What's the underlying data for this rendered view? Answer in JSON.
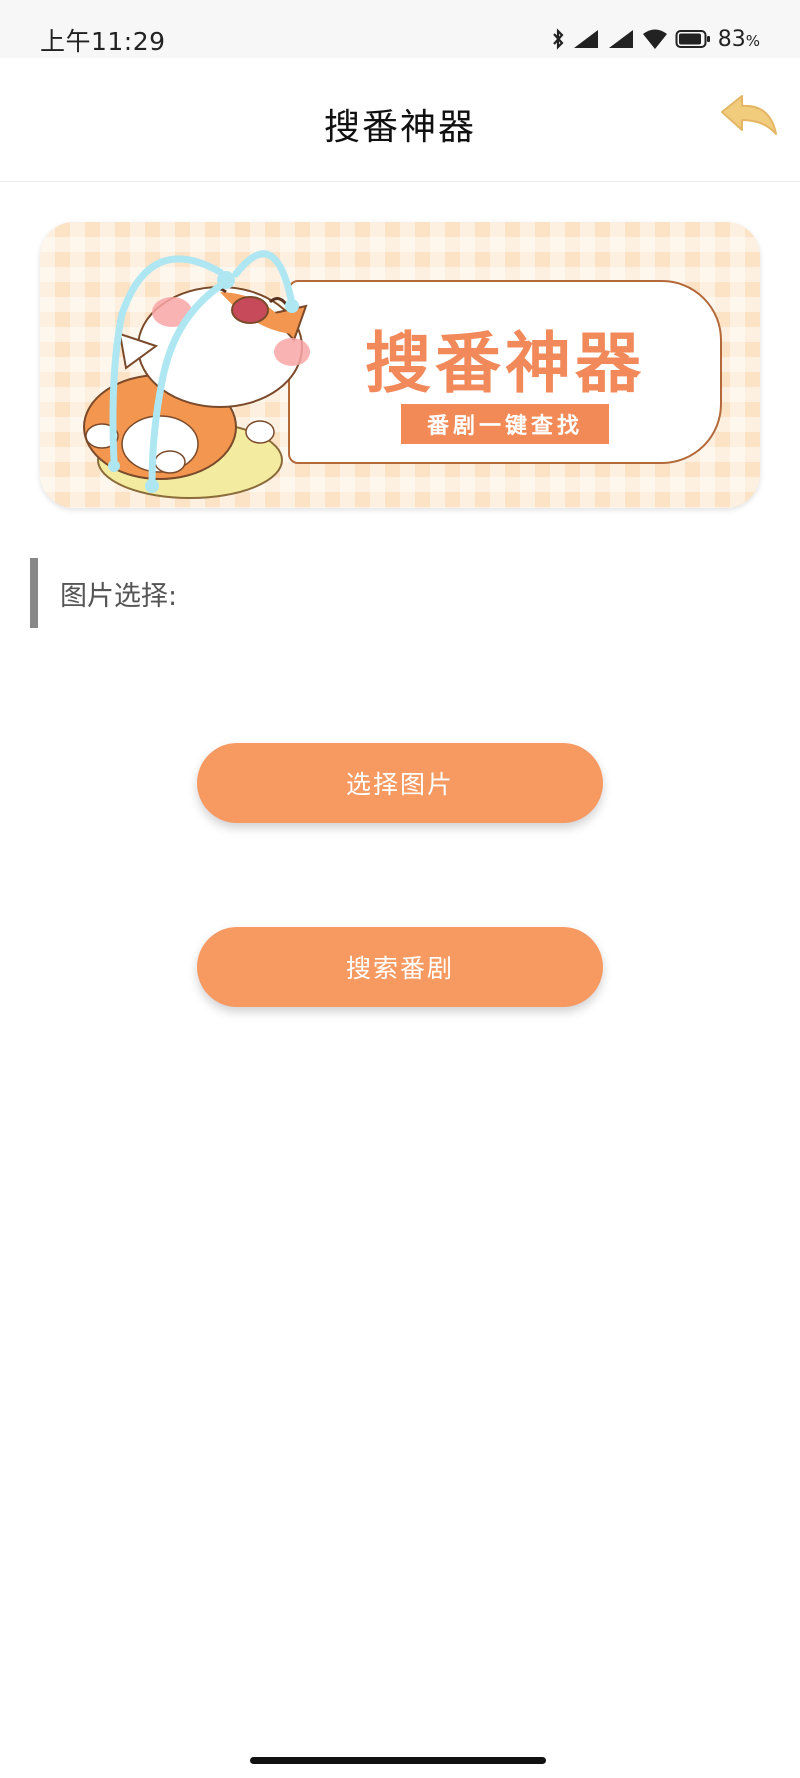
{
  "status_bar": {
    "time": "上午11:29",
    "battery_percent": "83",
    "battery_unit": "%",
    "icons": [
      "bluetooth-icon",
      "signal-icon",
      "signal-icon",
      "wifi-icon",
      "battery-icon"
    ]
  },
  "header": {
    "title": "搜番神器",
    "back_icon": "back-arrow-icon"
  },
  "banner": {
    "title": "搜番神器",
    "subtitle": "番剧一键查找",
    "illustration": "crying-cat-mascot"
  },
  "section": {
    "label": "图片选择:"
  },
  "buttons": {
    "select_image": "选择图片",
    "search_anime": "搜索番剧"
  },
  "colors": {
    "accent": "#f69a62",
    "banner_bg": "#fde3c6",
    "banner_title": "#f1895a",
    "back_icon": "#f1cc7d"
  }
}
